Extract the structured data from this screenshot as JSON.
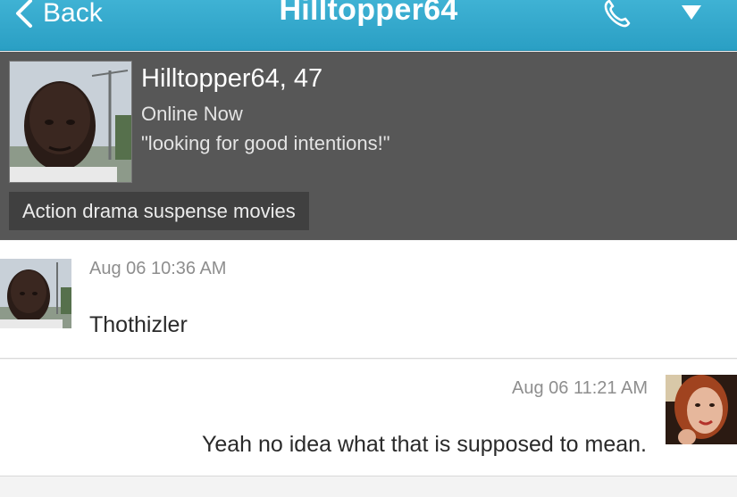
{
  "navbar": {
    "back_label": "Back",
    "title": "Hilltopper64",
    "phone_icon": "phone-icon",
    "menu_icon": "caret-down-icon",
    "color": "#2fa6cb"
  },
  "profile": {
    "name_age": "Hilltopper64, 47",
    "status": "Online Now",
    "tagline": "\"looking for good intentions!\"",
    "interests": "Action drama suspense movies",
    "background_color": "#575757"
  },
  "messages": [
    {
      "timestamp": "Aug 06 10:36 AM",
      "text": "Thothizler",
      "sender": "them"
    },
    {
      "timestamp": "Aug 06 11:21 AM",
      "text": "Yeah no idea what that is supposed to mean.",
      "sender": "me"
    }
  ]
}
